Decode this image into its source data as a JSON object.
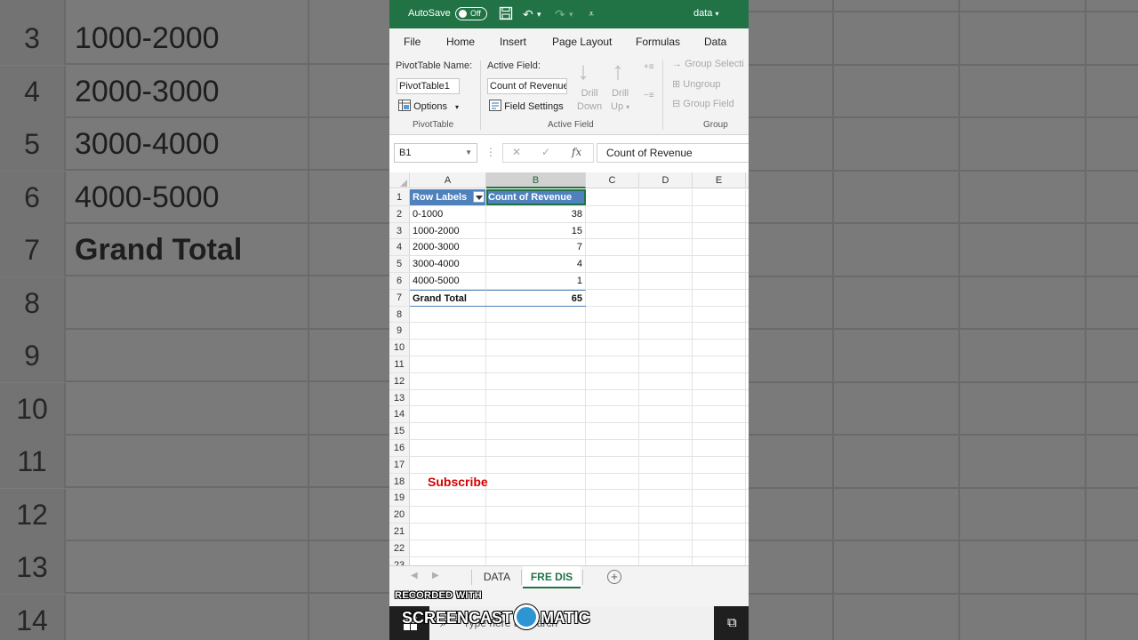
{
  "background": {
    "rows": [
      {
        "num": "3",
        "value": "1000-2000",
        "bold": false
      },
      {
        "num": "4",
        "value": "2000-3000",
        "bold": false
      },
      {
        "num": "5",
        "value": "3000-4000",
        "bold": false
      },
      {
        "num": "6",
        "value": "4000-5000",
        "bold": false
      },
      {
        "num": "7",
        "value": "Grand Total",
        "bold": true
      },
      {
        "num": "8",
        "value": "",
        "bold": false
      },
      {
        "num": "9",
        "value": "",
        "bold": false
      },
      {
        "num": "10",
        "value": "",
        "bold": false
      },
      {
        "num": "11",
        "value": "",
        "bold": false
      },
      {
        "num": "12",
        "value": "",
        "bold": false
      },
      {
        "num": "13",
        "value": "",
        "bold": false
      },
      {
        "num": "14",
        "value": "",
        "bold": false
      }
    ]
  },
  "titlebar": {
    "autosave_label": "AutoSave",
    "autosave_state": "Off",
    "doc_name": "data"
  },
  "menu_tabs": [
    "File",
    "Home",
    "Insert",
    "Page Layout",
    "Formulas",
    "Data"
  ],
  "ribbon": {
    "pivot_name_label": "PivotTable Name:",
    "pivot_name_value": "PivotTable1",
    "options_label": "Options",
    "pivot_group": "PivotTable",
    "active_field_label": "Active Field:",
    "active_field_value": "Count of Revenue",
    "field_settings_label": "Field Settings",
    "drill_down_label": [
      "Drill",
      "Down"
    ],
    "drill_up_label": [
      "Drill",
      "Up"
    ],
    "active_field_group": "Active Field",
    "group_selection_label": "Group Selecti",
    "ungroup_label": "Ungroup",
    "group_field_label": "Group Field",
    "group_group": "Group"
  },
  "formula_bar": {
    "name_box": "B1",
    "fx": "fx",
    "content": "Count of Revenue"
  },
  "columns": [
    "A",
    "B",
    "C",
    "D",
    "E"
  ],
  "pivot": {
    "header_a": "Row Labels",
    "header_b": "Count of Revenue",
    "rows": [
      {
        "label": "0-1000",
        "count": "38"
      },
      {
        "label": "1000-2000",
        "count": "15"
      },
      {
        "label": "2000-3000",
        "count": "7"
      },
      {
        "label": "3000-4000",
        "count": "4"
      },
      {
        "label": "4000-5000",
        "count": "1"
      }
    ],
    "total_label": "Grand Total",
    "total_count": "65"
  },
  "row_numbers": [
    "1",
    "2",
    "3",
    "4",
    "5",
    "6",
    "7",
    "8",
    "9",
    "10",
    "11",
    "12",
    "13",
    "14",
    "15",
    "16",
    "17",
    "18",
    "19",
    "20",
    "21",
    "22",
    "23"
  ],
  "overlay_text": "Subscribe",
  "sheet_tabs": {
    "tabs": [
      "DATA",
      "FRE DIS"
    ],
    "active": "FRE DIS"
  },
  "status": {
    "text": "R"
  },
  "taskbar": {
    "search_placeholder": "Type here to search"
  },
  "watermark": {
    "recorded": "RECORDED WITH",
    "brand_left": "SCREENCAST",
    "brand_right": "MATIC"
  },
  "colors": {
    "excel_green": "#217346",
    "pivot_header": "#4f81bd",
    "subscribe_red": "#d40000"
  }
}
